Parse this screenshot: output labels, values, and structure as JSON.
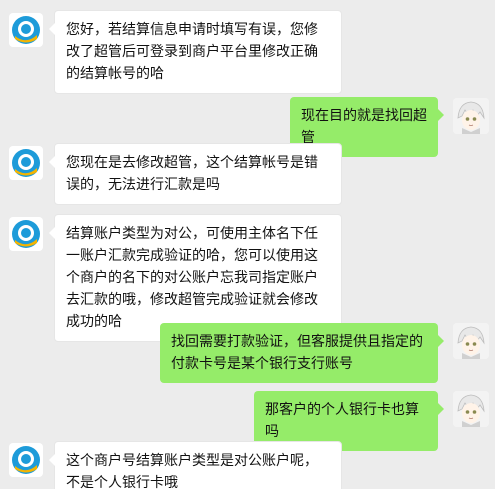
{
  "colors": {
    "background": "#ececec",
    "incoming_bubble": "#ffffff",
    "outgoing_bubble": "#95ec69",
    "agent_avatar_blue": "#1d9bd9",
    "agent_avatar_yellow": "#f5b400"
  },
  "messages": [
    {
      "sender": "agent",
      "avatar_icon": "support-bot-icon",
      "text": "您好，若结算信息申请时填写有误，您修改了超管后可登录到商户平台里修改正确的结算帐号的哈"
    },
    {
      "sender": "user",
      "avatar_icon": "anime-character-avatar",
      "text": "现在目的就是找回超管"
    },
    {
      "sender": "agent",
      "avatar_icon": "support-bot-icon",
      "text": "您现在是去修改超管，这个结算帐号是错误的，无法进行汇款是吗"
    },
    {
      "sender": "agent",
      "avatar_icon": "support-bot-icon",
      "text": "结算账户类型为对公，可使用主体名下任一账户汇款完成验证的哈，您可以使用这个商户的名下的对公账户忘我司指定账户去汇款的哦，修改超管完成验证就会修改成功的哈"
    },
    {
      "sender": "user",
      "avatar_icon": "anime-character-avatar",
      "text": "找回需要打款验证，但客服提供且指定的付款卡号是某个银行支行账号"
    },
    {
      "sender": "user",
      "avatar_icon": "anime-character-avatar",
      "text": "那客户的个人银行卡也算吗"
    },
    {
      "sender": "agent",
      "avatar_icon": "support-bot-icon",
      "text": "这个商户号结算账户类型是对公账户呢，不是个人银行卡哦"
    }
  ]
}
